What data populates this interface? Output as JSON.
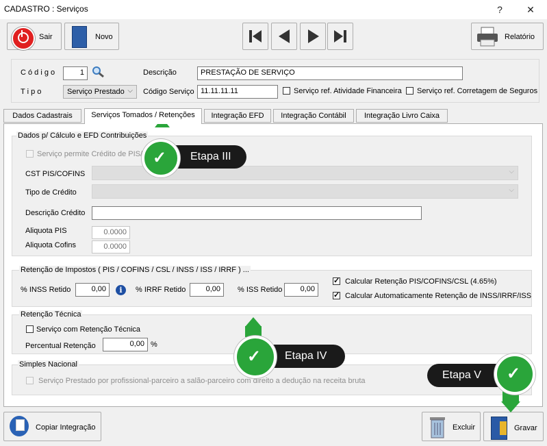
{
  "window": {
    "title": "CADASTRO : Serviços",
    "help": "?",
    "close": "✕"
  },
  "toolbar": {
    "sair": "Sair",
    "novo": "Novo",
    "relatorio": "Relatório"
  },
  "form": {
    "codigo_label": "C ó d i g o",
    "codigo_value": "1",
    "descricao_label": "Descrição",
    "descricao_value": "PRESTAÇÃO DE SERVIÇO",
    "tipo_label": "T i p o",
    "tipo_value": "Serviço Prestado",
    "codigo_servico_label": "Código Serviço",
    "codigo_servico_value": "11.11.11.11",
    "chk_atividade": "Serviço ref. Atividade Financeira",
    "chk_corretagem": "Serviço ref. Corretagem de Seguros"
  },
  "tabs": [
    "Dados Cadastrais",
    "Serviços Tomados / Retenções",
    "Integração EFD",
    "Integração Contábil",
    "Integração Livro Caixa"
  ],
  "dados_pis": {
    "group_label": "Dados p/ Cálculo e EFD Contribuições",
    "chk_credito": "Serviço permite Crédito de PIS/",
    "cst_label": "CST PIS/COFINS",
    "tipo_credito_label": "Tipo de Crédito",
    "descricao_credito_label": "Descrição Crédito",
    "aliq_pis_label": "Aliquota  PIS",
    "aliq_pis_value": "0.0000",
    "aliq_cofins_label": "Aliquota  Cofins",
    "aliq_cofins_value": "0.0000"
  },
  "retencao": {
    "group_label": "Retenção de Impostos ( PIS / COFINS / CSL / INSS / ISS / IRRF )  ...",
    "inss_label": "% INSS Retido",
    "inss_value": "0,00",
    "irrf_label": "% IRRF Retido",
    "irrf_value": "0,00",
    "iss_label": "% ISS Retido",
    "iss_value": "0,00",
    "chk_calc_pis": "Calcular Retenção PIS/COFINS/CSL (4.65%)",
    "chk_calc_inss": "Calcular Automaticamente Retenção de INSS/IRRF/ISS"
  },
  "retencao_tecnica": {
    "group_label": "Retenção Técnica",
    "chk_label": "Serviço com Retenção Técnica",
    "percentual_label": "Percentual Retenção",
    "percentual_value": "0,00",
    "percent_sign": "%"
  },
  "simples": {
    "group_label": "Simples Nacional",
    "chk_label": "Serviço Prestado por profissional-parceiro a salão-parceiro com direito a dedução na receita bruta"
  },
  "bottom": {
    "copiar": "Copiar Integração",
    "excluir": "Excluir",
    "gravar": "Gravar"
  },
  "callouts": {
    "etapa3": "Etapa III",
    "etapa4": "Etapa IV",
    "etapa5": "Etapa V"
  },
  "colors": {
    "callout_green": "#2aa53a",
    "callout_dark": "#1a1a1a"
  }
}
